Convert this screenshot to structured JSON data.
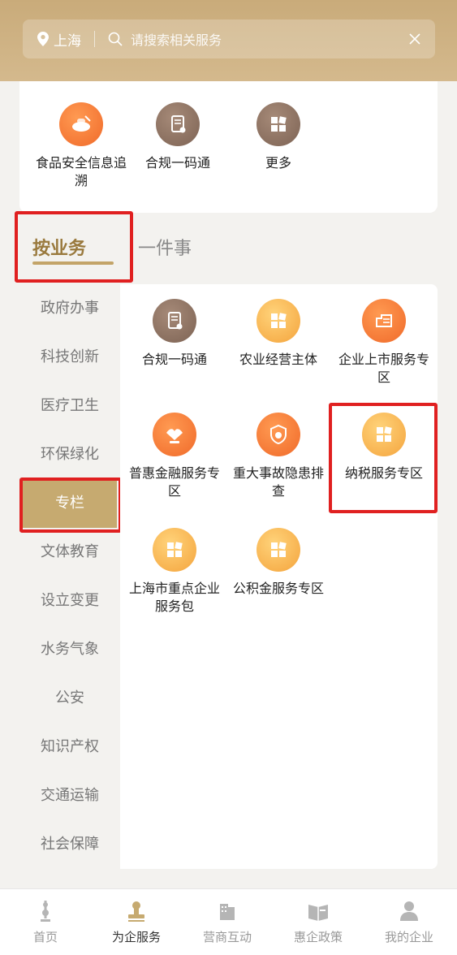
{
  "header": {
    "city": "上海",
    "search_placeholder": "请搜索相关服务"
  },
  "quick_services": [
    {
      "label": "食品安全信息追溯",
      "icon": "food-bowl-icon"
    },
    {
      "label": "合规一码通",
      "icon": "document-icon"
    },
    {
      "label": "更多",
      "icon": "grid-icon"
    }
  ],
  "tabs": {
    "primary": "按业务",
    "secondary": "一件事"
  },
  "categories": [
    "政府办事",
    "科技创新",
    "医疗卫生",
    "环保绿化",
    "专栏",
    "文体教育",
    "设立变更",
    "水务气象",
    "公安",
    "知识产权",
    "交通运输",
    "社会保障"
  ],
  "active_category": "专栏",
  "services": [
    {
      "label": "合规一码通",
      "icon": "document-icon"
    },
    {
      "label": "农业经营主体",
      "icon": "grid-icon"
    },
    {
      "label": "企业上市服务专区",
      "icon": "listing-icon"
    },
    {
      "label": "普惠金融服务专区",
      "icon": "handshake-icon"
    },
    {
      "label": "重大事故隐患排查",
      "icon": "shield-icon"
    },
    {
      "label": "纳税服务专区",
      "icon": "grid-icon"
    },
    {
      "label": "上海市重点企业服务包",
      "icon": "grid-icon"
    },
    {
      "label": "公积金服务专区",
      "icon": "grid-icon"
    }
  ],
  "bottom_nav": [
    {
      "label": "首页",
      "icon": "home-tower-icon"
    },
    {
      "label": "为企服务",
      "icon": "stamp-icon"
    },
    {
      "label": "营商互动",
      "icon": "building-icon"
    },
    {
      "label": "惠企政策",
      "icon": "book-icon"
    },
    {
      "label": "我的企业",
      "icon": "person-icon"
    }
  ],
  "colors": {
    "header": "#c9ab7a",
    "accent_gold": "#c6aa70",
    "highlight_red": "#e02020",
    "icon_orange": "#f06a2a",
    "icon_brown": "#7d6354",
    "icon_gold": "#f4a43d"
  }
}
